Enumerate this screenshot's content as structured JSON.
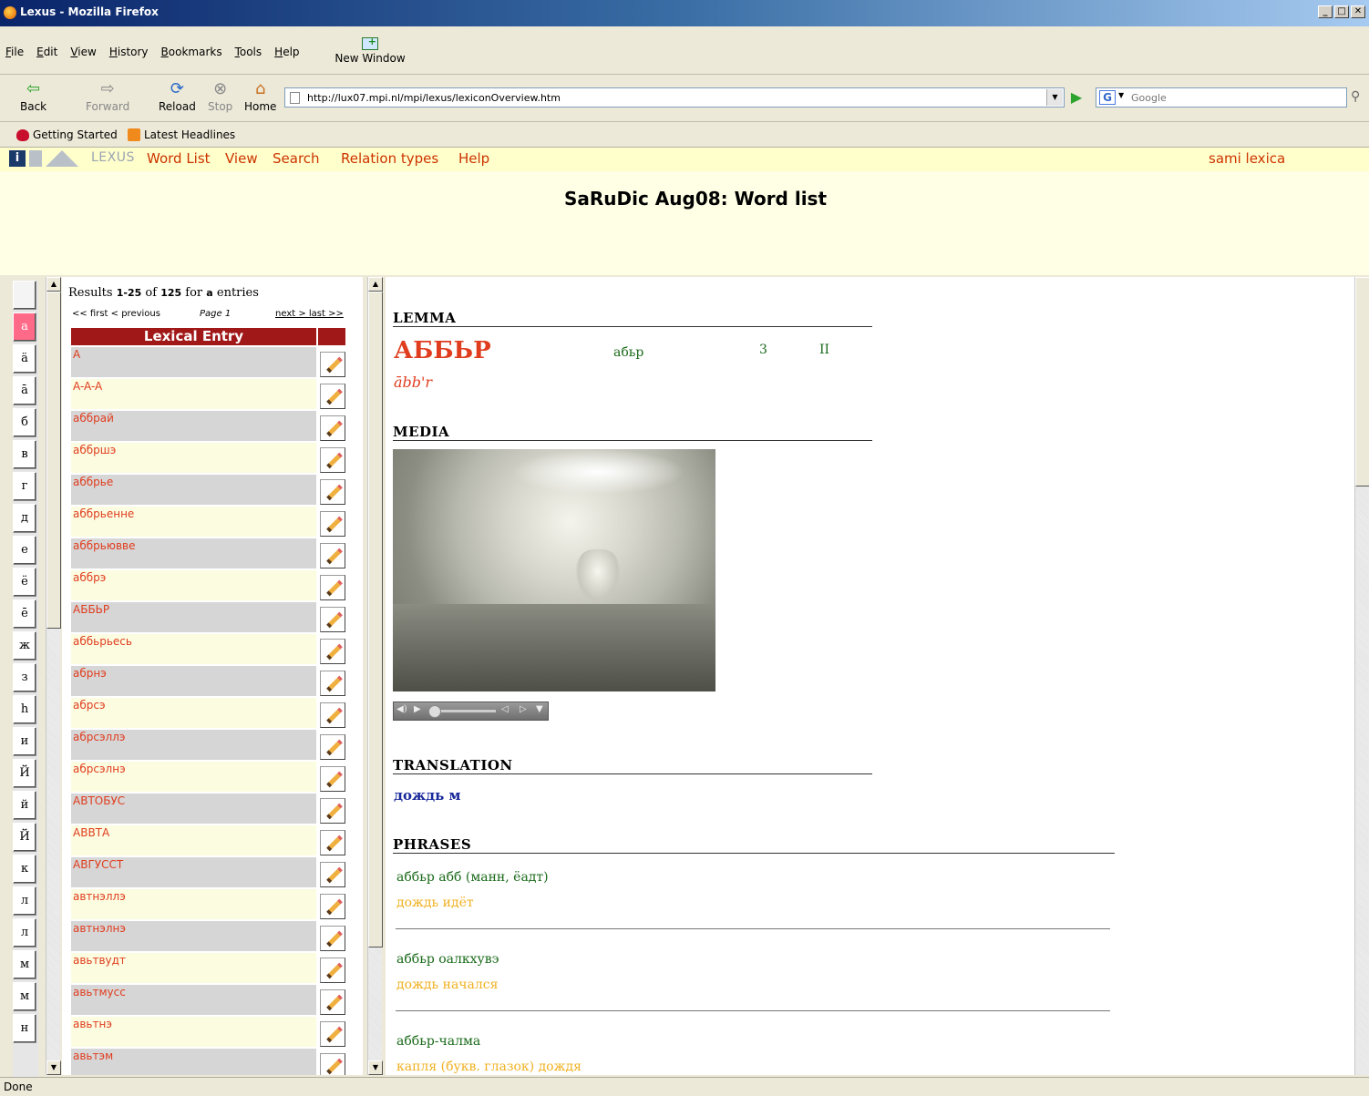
{
  "window": {
    "title": "Lexus - Mozilla Firefox",
    "buttons": [
      "_",
      "□",
      "✕"
    ]
  },
  "menubar": {
    "items": [
      "File",
      "Edit",
      "View",
      "History",
      "Bookmarks",
      "Tools",
      "Help"
    ],
    "new_window": "New Window"
  },
  "navbar": {
    "back": "Back",
    "forward": "Forward",
    "reload": "Reload",
    "stop": "Stop",
    "home": "Home",
    "url": "http://lux07.mpi.nl/mpi/lexus/lexiconOverview.htm",
    "search_placeholder": "Google"
  },
  "bookmarks": {
    "items": [
      "Getting Started",
      "Latest Headlines"
    ]
  },
  "lexus": {
    "logo_text": "LEXUS",
    "nav": [
      "Word List",
      "View",
      "Search",
      "Relation types",
      "Help"
    ],
    "user": "sami lexica",
    "page_title": "SaRuDic Aug08: Word list"
  },
  "alphabet": {
    "letters": [
      "",
      "a",
      "ä",
      "ā",
      "б",
      "в",
      "г",
      "д",
      "е",
      "ё",
      "ē",
      "ж",
      "з",
      "h",
      "и",
      "Й",
      "й",
      "Й",
      "к",
      "л",
      "л",
      "м",
      "м",
      "н"
    ],
    "active_index": 1
  },
  "wordlist": {
    "results_prefix": "Results",
    "results_range": "1-25",
    "results_of": "of",
    "results_total": "125",
    "results_for": "for",
    "results_query": "a",
    "results_suffix": "entries",
    "pager_first": "<< first < previous",
    "pager_page": "Page 1",
    "pager_next": "next > last >>",
    "column_header": "Lexical Entry",
    "entries": [
      "A",
      "A-A-A",
      "аббрай",
      "аббршэ",
      "аббрье",
      "аббрьенне",
      "аббрьювве",
      "аббрэ",
      "АББЬР",
      "аббьрьесь",
      "абрнэ",
      "абрсэ",
      "абрсэллэ",
      "абрсэлнэ",
      "АВТОБУС",
      "АВВТА",
      "АВГУССТ",
      "автнэллэ",
      "автнэлнэ",
      "авьтвудт",
      "авьтмусс",
      "авьтнэ",
      "авьтэм"
    ]
  },
  "entry": {
    "lemma_heading": "LEMMA",
    "lemma": "АББЬР",
    "form": "абьр",
    "number": "3",
    "roman": "II",
    "transcription": "ābb'r",
    "media_heading": "MEDIA",
    "translation_heading": "TRANSLATION",
    "translation": "дождь м",
    "phrases_heading": "PHRASES",
    "phrases": [
      {
        "text": "аббьр абб (манн, ёадт)",
        "translation": "дождь идёт"
      },
      {
        "text": "аббьр оалкхувэ",
        "translation": "дождь начался"
      },
      {
        "text": "аббьр-чалма",
        "translation": "капля (букв. глазок) дождя"
      }
    ]
  },
  "status": {
    "text": "Done"
  }
}
